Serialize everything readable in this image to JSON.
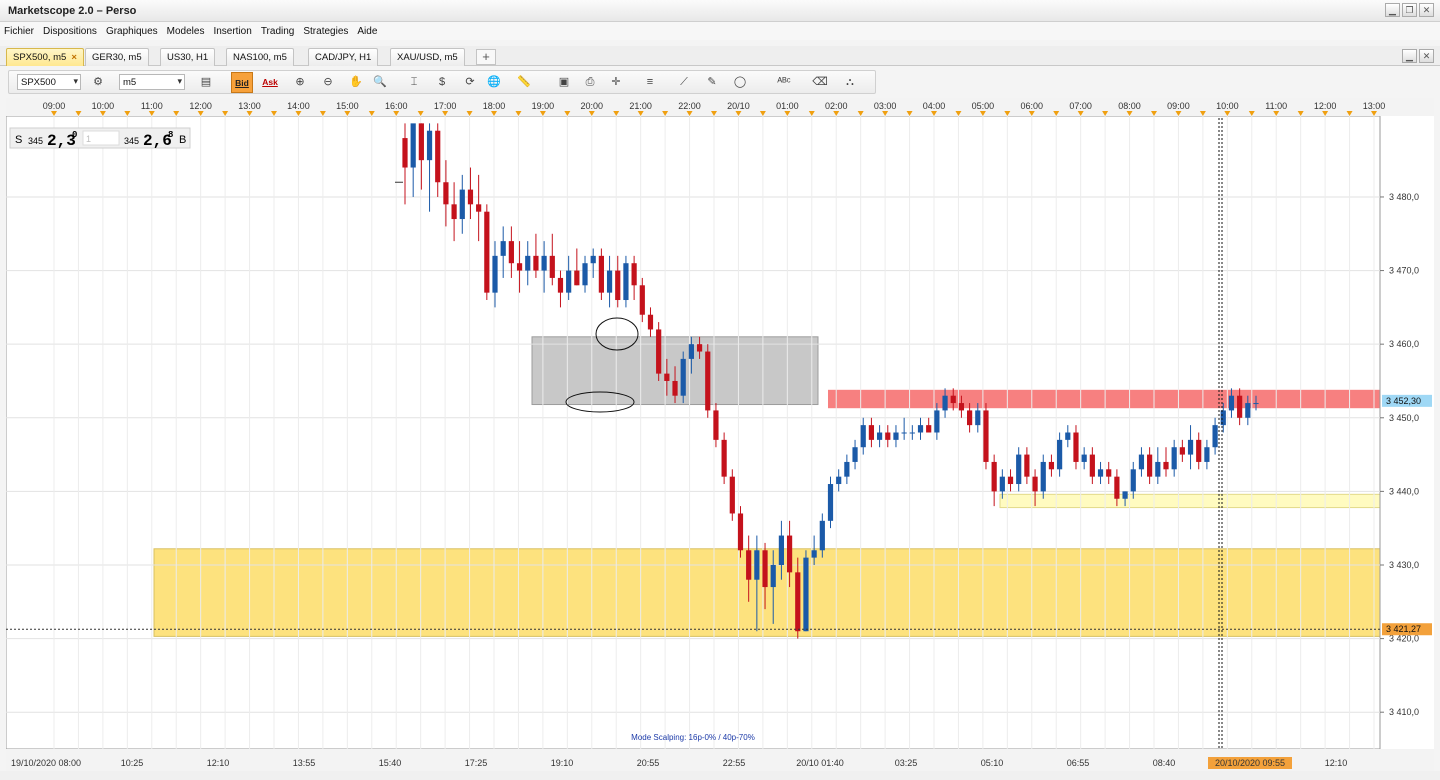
{
  "window": {
    "title": "Marketscope 2.0 – Perso",
    "btn_min": "▁",
    "btn_restore": "❐",
    "btn_close": "✕"
  },
  "menu": [
    "Fichier",
    "Dispositions",
    "Graphiques",
    "Modeles",
    "Insertion",
    "Trading",
    "Strategies",
    "Aide"
  ],
  "tabs": [
    {
      "label": "SPX500, m5",
      "active": true,
      "close": "×"
    },
    {
      "label": "GER30, m5",
      "active": false
    },
    {
      "label": "US30, H1",
      "active": false
    },
    {
      "label": "NAS100, m5",
      "active": false
    },
    {
      "label": "CAD/JPY, H1",
      "active": false
    },
    {
      "label": "XAU/USD, m5",
      "active": false
    }
  ],
  "tab_add": "+",
  "toolbar": {
    "instrument": "SPX500",
    "timeframe": "m5",
    "bid_label": "Bid",
    "ask_label": "Ask",
    "bid_active": true
  },
  "quote": {
    "sell_label": "S",
    "sell_prefix": "345",
    "sell_price": "2,3",
    "sell_sup": "0",
    "spread": "1",
    "buy_prefix": "345",
    "buy_price": "2,6",
    "buy_sup": "8",
    "buy_label": "B"
  },
  "chart_data": {
    "type": "candlestick",
    "instrument": "SPX500",
    "timeframe": "m5",
    "ylim": [
      3405,
      3491
    ],
    "y_ticks": [
      "3 480,0",
      "3 470,0",
      "3 460,0",
      "3 450,0",
      "3 440,0",
      "3 430,0",
      "3 420,0",
      "3 410,0"
    ],
    "y_tick_values": [
      3480,
      3470,
      3460,
      3450,
      3440,
      3430,
      3420,
      3410
    ],
    "top_time_labels": [
      "09:00",
      "10:00",
      "11:00",
      "12:00",
      "13:00",
      "14:00",
      "15:00",
      "16:00",
      "17:00",
      "18:00",
      "19:00",
      "20:00",
      "21:00",
      "22:00",
      "20/10",
      "01:00",
      "02:00",
      "03:00",
      "04:00",
      "05:00",
      "06:00",
      "07:00",
      "08:00",
      "09:00",
      "10:00",
      "11:00",
      "12:00",
      "13:00"
    ],
    "bottom_time_labels": [
      "19/10/2020 08:00",
      "10:25",
      "12:10",
      "13:55",
      "15:40",
      "17:25",
      "19:10",
      "20:55",
      "22:55",
      "20/10 01:40",
      "03:25",
      "05:10",
      "06:55",
      "08:40",
      "20/10/2020 09:55",
      "12:10"
    ],
    "current_price_label": "3 452,30",
    "current_price": 3452.3,
    "hline_price_label": "3 421,27",
    "hline_price": 3421.27,
    "cursor_time_label": "20/10/2020 09:55",
    "annotation": "Mode Scalping: 16p-0% / 40p-70%",
    "zones": [
      {
        "color": "#c8c8c8",
        "from": 3451.8,
        "to": 3461.0
      },
      {
        "color": "#f78080",
        "from": 3451.3,
        "to": 3453.8
      },
      {
        "color": "#fffbc0",
        "from": 3437.8,
        "to": 3439.6
      },
      {
        "color": "#fde27e",
        "from": 3420.3,
        "to": 3432.2
      }
    ],
    "candle_colors": {
      "up": "#1b5aa8",
      "down": "#c4121c"
    },
    "candles": [
      {
        "o": 3488,
        "h": 3490,
        "l": 3479,
        "c": 3484
      },
      {
        "o": 3484,
        "h": 3487,
        "l": 3480,
        "c": 3490
      },
      {
        "o": 3490,
        "h": 3490,
        "l": 3481,
        "c": 3485
      },
      {
        "o": 3485,
        "h": 3490,
        "l": 3478,
        "c": 3489
      },
      {
        "o": 3489,
        "h": 3490,
        "l": 3480,
        "c": 3482
      },
      {
        "o": 3482,
        "h": 3485,
        "l": 3476,
        "c": 3479
      },
      {
        "o": 3479,
        "h": 3482,
        "l": 3474,
        "c": 3477
      },
      {
        "o": 3477,
        "h": 3483,
        "l": 3475,
        "c": 3481
      },
      {
        "o": 3481,
        "h": 3484,
        "l": 3477,
        "c": 3479
      },
      {
        "o": 3479,
        "h": 3483,
        "l": 3474,
        "c": 3478
      },
      {
        "o": 3478,
        "h": 3479,
        "l": 3466,
        "c": 3467
      },
      {
        "o": 3467,
        "h": 3474,
        "l": 3465,
        "c": 3472
      },
      {
        "o": 3472,
        "h": 3476,
        "l": 3469,
        "c": 3474
      },
      {
        "o": 3474,
        "h": 3476,
        "l": 3469,
        "c": 3471
      },
      {
        "o": 3471,
        "h": 3474,
        "l": 3467,
        "c": 3470
      },
      {
        "o": 3470,
        "h": 3474,
        "l": 3468,
        "c": 3472
      },
      {
        "o": 3472,
        "h": 3475,
        "l": 3469,
        "c": 3470
      },
      {
        "o": 3470,
        "h": 3474,
        "l": 3467,
        "c": 3472
      },
      {
        "o": 3472,
        "h": 3475,
        "l": 3468,
        "c": 3469
      },
      {
        "o": 3469,
        "h": 3470,
        "l": 3465,
        "c": 3467
      },
      {
        "o": 3467,
        "h": 3472,
        "l": 3466,
        "c": 3470
      },
      {
        "o": 3470,
        "h": 3473,
        "l": 3468,
        "c": 3468
      },
      {
        "o": 3468,
        "h": 3472,
        "l": 3467,
        "c": 3471
      },
      {
        "o": 3471,
        "h": 3473,
        "l": 3469,
        "c": 3472
      },
      {
        "o": 3472,
        "h": 3473,
        "l": 3466,
        "c": 3467
      },
      {
        "o": 3467,
        "h": 3472,
        "l": 3465,
        "c": 3470
      },
      {
        "o": 3470,
        "h": 3472,
        "l": 3465,
        "c": 3466
      },
      {
        "o": 3466,
        "h": 3472,
        "l": 3465,
        "c": 3471
      },
      {
        "o": 3471,
        "h": 3472,
        "l": 3466,
        "c": 3468
      },
      {
        "o": 3468,
        "h": 3469,
        "l": 3463,
        "c": 3464
      },
      {
        "o": 3464,
        "h": 3465,
        "l": 3461,
        "c": 3462
      },
      {
        "o": 3462,
        "h": 3463,
        "l": 3455,
        "c": 3456
      },
      {
        "o": 3456,
        "h": 3458,
        "l": 3453,
        "c": 3455
      },
      {
        "o": 3455,
        "h": 3457,
        "l": 3452,
        "c": 3453
      },
      {
        "o": 3453,
        "h": 3459,
        "l": 3452,
        "c": 3458
      },
      {
        "o": 3458,
        "h": 3461,
        "l": 3456,
        "c": 3460
      },
      {
        "o": 3460,
        "h": 3461,
        "l": 3458,
        "c": 3459
      },
      {
        "o": 3459,
        "h": 3460,
        "l": 3450,
        "c": 3451
      },
      {
        "o": 3451,
        "h": 3452,
        "l": 3446,
        "c": 3447
      },
      {
        "o": 3447,
        "h": 3448,
        "l": 3441,
        "c": 3442
      },
      {
        "o": 3442,
        "h": 3443,
        "l": 3436,
        "c": 3437
      },
      {
        "o": 3437,
        "h": 3438,
        "l": 3431,
        "c": 3432
      },
      {
        "o": 3432,
        "h": 3434,
        "l": 3425,
        "c": 3428
      },
      {
        "o": 3428,
        "h": 3434,
        "l": 3421,
        "c": 3432
      },
      {
        "o": 3432,
        "h": 3433,
        "l": 3424,
        "c": 3427
      },
      {
        "o": 3427,
        "h": 3432,
        "l": 3422,
        "c": 3430
      },
      {
        "o": 3430,
        "h": 3436,
        "l": 3428,
        "c": 3434
      },
      {
        "o": 3434,
        "h": 3436,
        "l": 3427,
        "c": 3429
      },
      {
        "o": 3429,
        "h": 3431,
        "l": 3420,
        "c": 3421
      },
      {
        "o": 3421,
        "h": 3432,
        "l": 3421,
        "c": 3431
      },
      {
        "o": 3431,
        "h": 3434,
        "l": 3430,
        "c": 3432
      },
      {
        "o": 3432,
        "h": 3437,
        "l": 3431,
        "c": 3436
      },
      {
        "o": 3436,
        "h": 3442,
        "l": 3435,
        "c": 3441
      },
      {
        "o": 3441,
        "h": 3443,
        "l": 3440,
        "c": 3442
      },
      {
        "o": 3442,
        "h": 3445,
        "l": 3441,
        "c": 3444
      },
      {
        "o": 3444,
        "h": 3447,
        "l": 3443,
        "c": 3446
      },
      {
        "o": 3446,
        "h": 3450,
        "l": 3445,
        "c": 3449
      },
      {
        "o": 3449,
        "h": 3450,
        "l": 3446,
        "c": 3447
      },
      {
        "o": 3447,
        "h": 3449,
        "l": 3446,
        "c": 3448
      },
      {
        "o": 3448,
        "h": 3449,
        "l": 3446,
        "c": 3447
      },
      {
        "o": 3447,
        "h": 3449,
        "l": 3446,
        "c": 3448
      },
      {
        "o": 3448,
        "h": 3450,
        "l": 3447,
        "c": 3448
      },
      {
        "o": 3448,
        "h": 3449,
        "l": 3447,
        "c": 3448
      },
      {
        "o": 3448,
        "h": 3450,
        "l": 3447,
        "c": 3449
      },
      {
        "o": 3449,
        "h": 3450,
        "l": 3448,
        "c": 3448
      },
      {
        "o": 3448,
        "h": 3452,
        "l": 3447,
        "c": 3451
      },
      {
        "o": 3451,
        "h": 3454,
        "l": 3450,
        "c": 3453
      },
      {
        "o": 3453,
        "h": 3454,
        "l": 3451,
        "c": 3452
      },
      {
        "o": 3452,
        "h": 3453,
        "l": 3450,
        "c": 3451
      },
      {
        "o": 3451,
        "h": 3452,
        "l": 3448,
        "c": 3449
      },
      {
        "o": 3449,
        "h": 3452,
        "l": 3448,
        "c": 3451
      },
      {
        "o": 3451,
        "h": 3452,
        "l": 3443,
        "c": 3444
      },
      {
        "o": 3444,
        "h": 3445,
        "l": 3438,
        "c": 3440
      },
      {
        "o": 3440,
        "h": 3443,
        "l": 3439,
        "c": 3442
      },
      {
        "o": 3442,
        "h": 3443,
        "l": 3440,
        "c": 3441
      },
      {
        "o": 3441,
        "h": 3446,
        "l": 3440,
        "c": 3445
      },
      {
        "o": 3445,
        "h": 3446,
        "l": 3441,
        "c": 3442
      },
      {
        "o": 3442,
        "h": 3443,
        "l": 3438,
        "c": 3440
      },
      {
        "o": 3440,
        "h": 3445,
        "l": 3439,
        "c": 3444
      },
      {
        "o": 3444,
        "h": 3445,
        "l": 3442,
        "c": 3443
      },
      {
        "o": 3443,
        "h": 3448,
        "l": 3442,
        "c": 3447
      },
      {
        "o": 3447,
        "h": 3449,
        "l": 3446,
        "c": 3448
      },
      {
        "o": 3448,
        "h": 3449,
        "l": 3443,
        "c": 3444
      },
      {
        "o": 3444,
        "h": 3446,
        "l": 3443,
        "c": 3445
      },
      {
        "o": 3445,
        "h": 3446,
        "l": 3441,
        "c": 3442
      },
      {
        "o": 3442,
        "h": 3444,
        "l": 3441,
        "c": 3443
      },
      {
        "o": 3443,
        "h": 3444,
        "l": 3441,
        "c": 3442
      },
      {
        "o": 3442,
        "h": 3443,
        "l": 3438,
        "c": 3439
      },
      {
        "o": 3439,
        "h": 3440,
        "l": 3438,
        "c": 3440
      },
      {
        "o": 3440,
        "h": 3444,
        "l": 3439,
        "c": 3443
      },
      {
        "o": 3443,
        "h": 3446,
        "l": 3442,
        "c": 3445
      },
      {
        "o": 3445,
        "h": 3446,
        "l": 3441,
        "c": 3442
      },
      {
        "o": 3442,
        "h": 3446,
        "l": 3441,
        "c": 3444
      },
      {
        "o": 3444,
        "h": 3446,
        "l": 3442,
        "c": 3443
      },
      {
        "o": 3443,
        "h": 3447,
        "l": 3442,
        "c": 3446
      },
      {
        "o": 3446,
        "h": 3447,
        "l": 3444,
        "c": 3445
      },
      {
        "o": 3445,
        "h": 3449,
        "l": 3443,
        "c": 3447
      },
      {
        "o": 3447,
        "h": 3448,
        "l": 3443,
        "c": 3444
      },
      {
        "o": 3444,
        "h": 3447,
        "l": 3443,
        "c": 3446
      },
      {
        "o": 3446,
        "h": 3450,
        "l": 3445,
        "c": 3449
      },
      {
        "o": 3449,
        "h": 3452,
        "l": 3448,
        "c": 3451
      },
      {
        "o": 3451,
        "h": 3454,
        "l": 3450,
        "c": 3453
      },
      {
        "o": 3453,
        "h": 3454,
        "l": 3449,
        "c": 3450
      },
      {
        "o": 3450,
        "h": 3453,
        "l": 3449,
        "c": 3452
      },
      {
        "o": 3452,
        "h": 3453,
        "l": 3451,
        "c": 3452
      }
    ]
  }
}
